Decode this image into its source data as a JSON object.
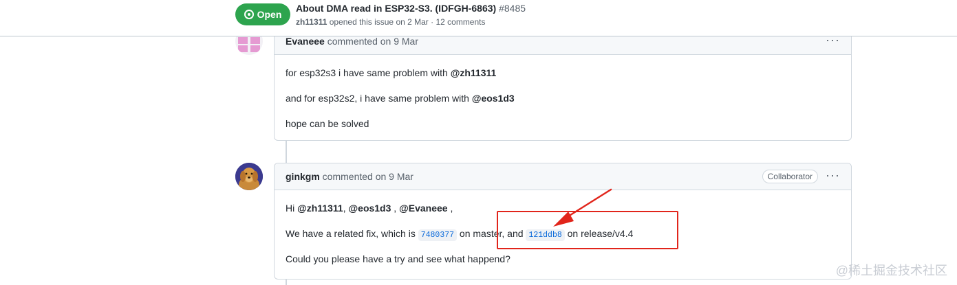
{
  "header": {
    "state_label": "Open",
    "issue_title": "About DMA read in ESP32-S3. (IDFGH-6863)",
    "issue_number": "#8485",
    "opener": "zh11311",
    "meta_text": " opened this issue on 2 Mar · 12 comments"
  },
  "comments": [
    {
      "author": "Evaneee",
      "action": " commented on 9 Mar",
      "menu_label": "···",
      "body": {
        "line1_prefix": "for esp32s3 i have same problem with ",
        "line1_mention": "@zh11311",
        "line2_prefix": "and for esp32s2, i have same problem with ",
        "line2_mention": "@eos1d3",
        "line3": "hope can be solved"
      }
    },
    {
      "author": "ginkgm",
      "action": " commented on 9 Mar",
      "badge": "Collaborator",
      "menu_label": "···",
      "body": {
        "greeting": "Hi ",
        "mention1": "@zh11311",
        "sep1": ", ",
        "mention2": "@eos1d3",
        "sep2": " , ",
        "mention3": "@Evaneee",
        "end1": " ,",
        "fix_prefix": "We have a related fix, which is ",
        "commit1": "7480377",
        "fix_mid": " on master, and ",
        "commit2": "121ddb8",
        "fix_end": " on release/v4.4",
        "question": "Could you please have a try and see what happend?"
      }
    }
  ],
  "watermark": "@稀土掘金技术社区",
  "colors": {
    "open_green": "#2da44e",
    "annotation_red": "#e1251b",
    "link_blue": "#0969da"
  },
  "icons": [
    "issue-opened-icon",
    "kebab-horizontal-icon"
  ]
}
